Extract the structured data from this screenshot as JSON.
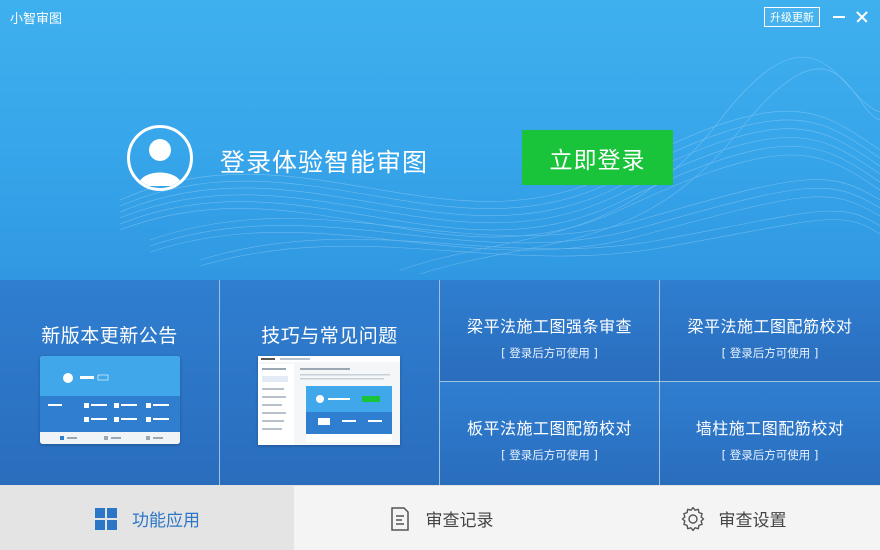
{
  "window": {
    "title": "小智审图",
    "upgrade_label": "升级更新",
    "minimize_icon": "minimize-icon",
    "close_icon": "close-icon"
  },
  "hero": {
    "avatar_icon": "user-avatar-icon",
    "prompt": "登录体验智能审图",
    "login_label": "立即登录",
    "login_color": "#19c43b"
  },
  "tiles": {
    "announcement": {
      "title": "新版本更新公告"
    },
    "faq": {
      "title": "技巧与常见问题"
    },
    "beam_review": {
      "title": "梁平法施工图强条审查",
      "note": "[ 登录后方可使用 ]"
    },
    "beam_rebar": {
      "title": "梁平法施工图配筋校对",
      "note": "[ 登录后方可使用 ]"
    },
    "slab_rebar": {
      "title": "板平法施工图配筋校对",
      "note": "[ 登录后方可使用 ]"
    },
    "wall_rebar": {
      "title": "墙柱施工图配筋校对",
      "note": "[ 登录后方可使用 ]"
    }
  },
  "nav": {
    "items": [
      {
        "label": "功能应用",
        "icon": "grid-icon",
        "active": true
      },
      {
        "label": "审查记录",
        "icon": "document-icon",
        "active": false
      },
      {
        "label": "审查设置",
        "icon": "gear-icon",
        "active": false
      }
    ]
  },
  "colors": {
    "header_blue": "#3aaaec",
    "tile_blue": "#2d78c8",
    "login_green": "#19c43b",
    "active_nav_text": "#2c76c8"
  }
}
